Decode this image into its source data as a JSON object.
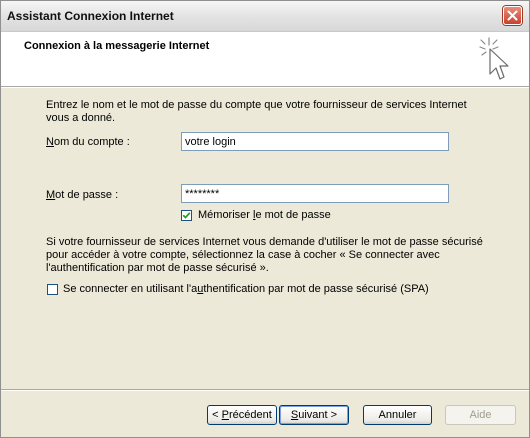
{
  "window": {
    "title": "Assistant Connexion Internet"
  },
  "header": {
    "title": "Connexion à la messagerie Internet"
  },
  "intro_line1": "Entrez le nom et le mot de passe du compte que votre fournisseur de services Internet",
  "intro_line2": "vous a donné.",
  "account": {
    "label_key": "N",
    "label_rest": "om du compte :",
    "value": "votre login"
  },
  "password": {
    "label_key": "M",
    "label_rest": "ot de passe :",
    "value": "********"
  },
  "remember": {
    "label_pre": "Mémoriser ",
    "label_key": "l",
    "label_post": "e mot de passe",
    "checked": true
  },
  "spa_info_line1": "Si votre fournisseur de services Internet vous demande d'utiliser le mot de passe sécurisé",
  "spa_info_line2": "pour accéder à votre compte, sélectionnez la case à cocher « Se connecter avec",
  "spa_info_line3": "l'authentification par mot de passe sécurisé ».",
  "spa": {
    "label_pre": "Se connecter en utilisant l'a",
    "label_key": "u",
    "label_post": "thentification par mot de passe sécurisé (SPA)",
    "checked": false
  },
  "buttons": {
    "back_pre": "< ",
    "back_key": "P",
    "back_post": "récédent",
    "next_key": "S",
    "next_post": "uivant >",
    "cancel": "Annuler",
    "help": "Aide"
  }
}
